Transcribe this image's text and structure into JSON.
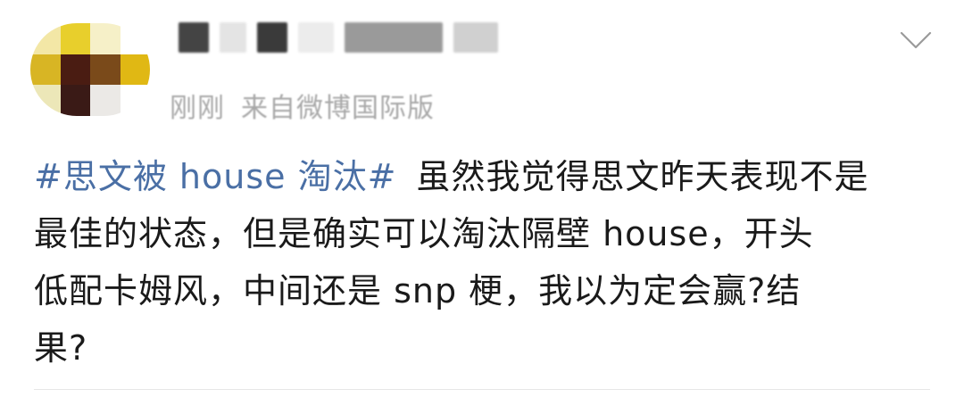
{
  "post": {
    "meta": {
      "time": "刚刚",
      "source": "来自微博国际版"
    },
    "body": {
      "hashtag": "#思文被 house 淘汰#",
      "lines": [
        "虽然我觉得思文昨天表现不是",
        "最佳的状态，但是确实可以淘汰隔壁 house，开头",
        "低配卡姆风，中间还是 snp 梗，我以为定会赢?结",
        "果?"
      ]
    },
    "icons": {
      "more": "chevron-down-icon",
      "avatar": "avatar-image"
    }
  },
  "colors": {
    "hashtag": "#4a6fa5",
    "text": "#1a1a1a",
    "meta": "#a8a8a8",
    "divider": "#e6e6e6"
  }
}
